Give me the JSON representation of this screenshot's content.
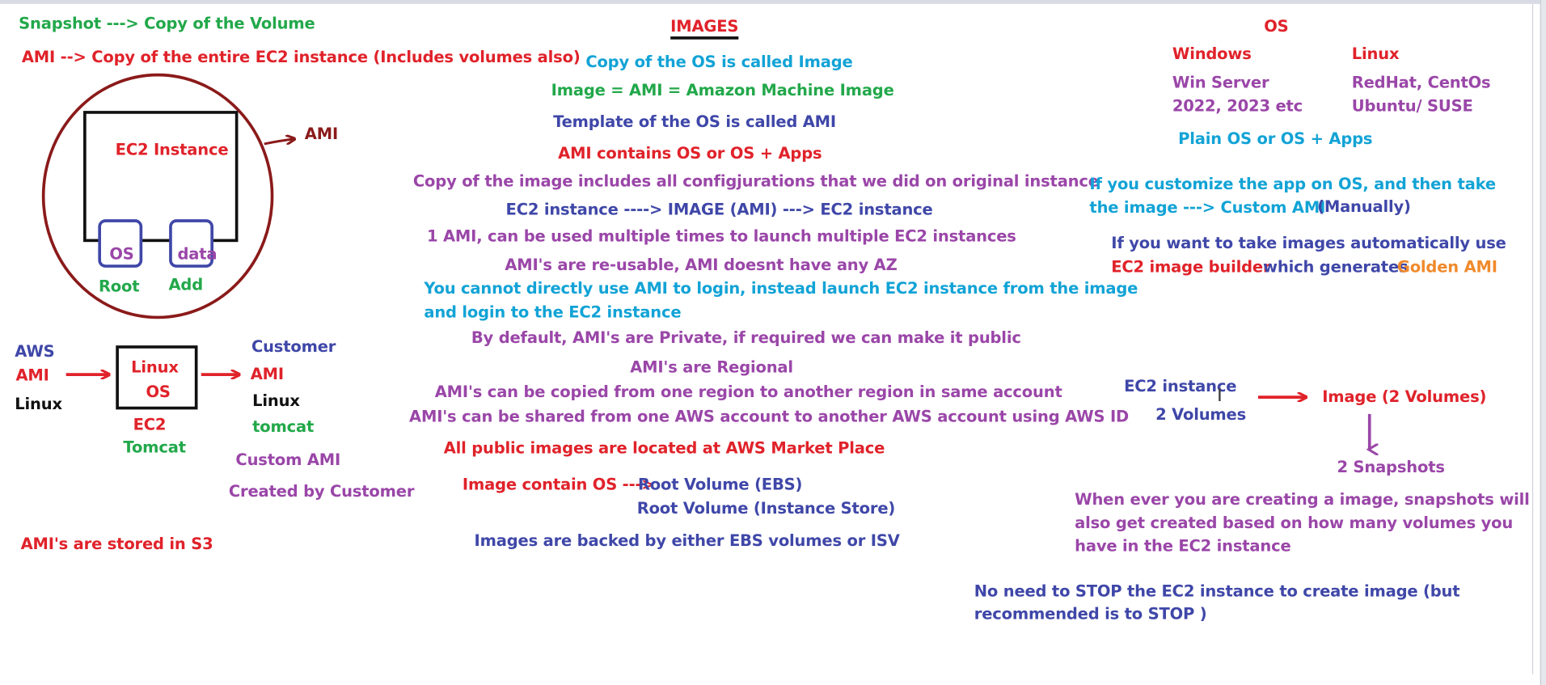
{
  "left": {
    "snapshot_def": "Snapshot ---> Copy of the Volume",
    "ami_def": "AMI --> Copy of the entire EC2 instance (Includes volumes also)",
    "ec2_instance_label": "EC2 Instance",
    "ami_arrow_label": "AMI",
    "os_label": "OS",
    "data_label": "data",
    "root_label": "Root",
    "add_label": "Add",
    "aws_label": "AWS",
    "aws_ami_label": "AMI",
    "aws_linux_label": "Linux",
    "box_linux": "Linux",
    "box_os": "OS",
    "ec2_label": "EC2",
    "tomcat_label": "Tomcat",
    "customer_label": "Customer",
    "customer_ami_label": "AMI",
    "customer_linux_label": "Linux",
    "customer_tomcat_label": "tomcat",
    "custom_ami_label": "Custom AMI",
    "created_by_label": "Created by Customer",
    "stored_s3": "AMI's are stored in S3"
  },
  "center": {
    "title": "IMAGES",
    "lines": [
      "Copy of the OS is called Image",
      "Image = AMI = Amazon Machine Image",
      "Template of the OS is called AMI",
      "AMI contains OS or OS + Apps",
      "Copy of the image includes all configjurations that we did on original instance",
      "EC2 instance ----> IMAGE (AMI) ---> EC2 instance",
      "1 AMI, can be used multiple times to launch multiple EC2 instances",
      "AMI's are re-usable, AMI doesnt have any AZ",
      "You cannot directly use AMI to login, instead launch EC2 instance from the image",
      "and login to the EC2 instance",
      "By default, AMI's are Private, if required we can make it public",
      "AMI's are Regional",
      "AMI's can be copied from one region to another region in same account",
      "AMI's can be shared from one AWS account to another AWS account using AWS ID",
      "All public images are located at AWS Market Place"
    ],
    "image_contain_prefix": "Image contain OS --->",
    "root_volume_ebs": "Root Volume (EBS)",
    "root_volume_is": "Root Volume (Instance Store)",
    "backed_by": "Images are backed by either EBS volumes or ISV"
  },
  "right": {
    "os_title": "OS",
    "windows": "Windows",
    "win_server_1": "Win Server",
    "win_server_2": "2022, 2023 etc",
    "linux": "Linux",
    "linux_1": "RedHat, CentOs",
    "linux_2": "Ubuntu/ SUSE",
    "plain_os": "Plain OS or OS + Apps",
    "customize_1": "If you customize the app on OS, and then take",
    "customize_2": "the image ---> Custom AMI",
    "manually": "(Manually)",
    "auto_1": "If you want to take images automatically use",
    "auto_builder": "EC2 image builder",
    "auto_which": "which generates",
    "auto_golden": "Golden AMI",
    "ec2_instance": "EC2 instance",
    "two_volumes": "2 Volumes",
    "image_two_volumes": "Image (2 Volumes)",
    "two_snapshots": "2 Snapshots",
    "snap_note_1": "When ever you are creating a image, snapshots will",
    "snap_note_2": "also get created based on how many volumes you",
    "snap_note_3": "have in the EC2 instance",
    "stop_note_1": "No need to STOP the EC2 instance to create image (but",
    "stop_note_2": "recommended is to STOP )"
  }
}
